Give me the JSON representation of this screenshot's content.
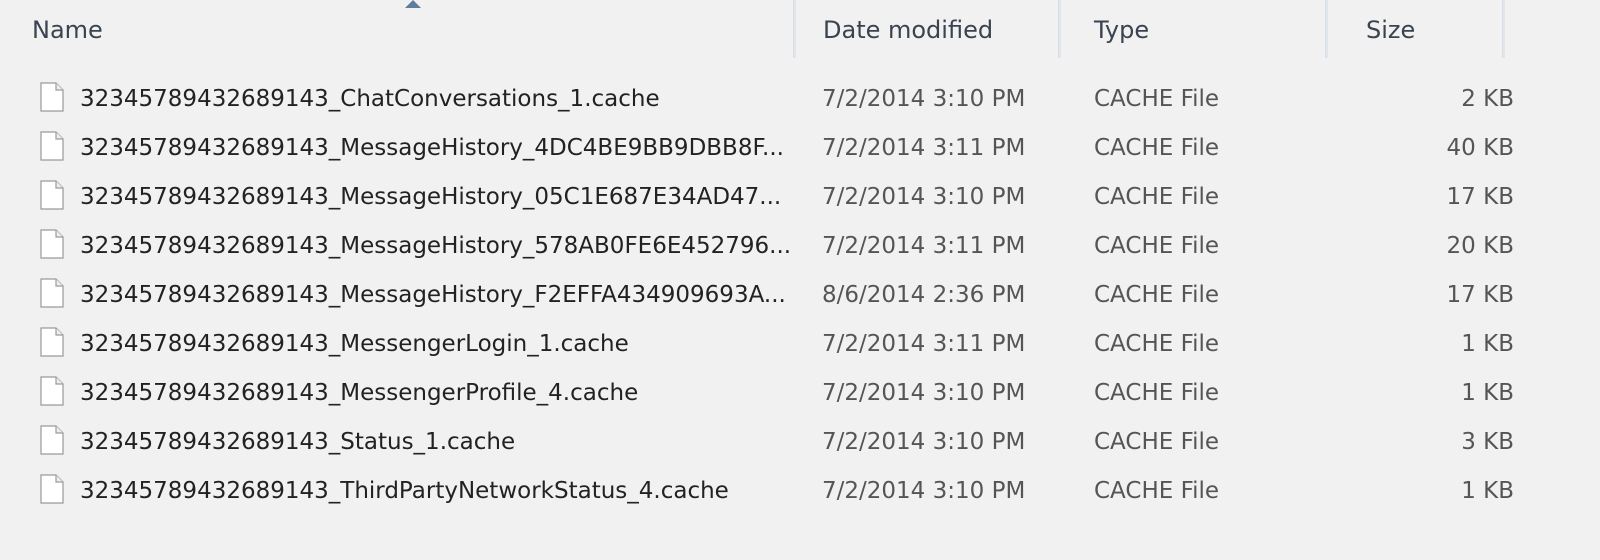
{
  "columns": {
    "name": "Name",
    "date_modified": "Date modified",
    "type": "Type",
    "size": "Size",
    "sort_icon": "sort-ascending-arrow"
  },
  "file_icon": "blank-document-icon",
  "files": [
    {
      "name": "32345789432689143_ChatConversations_1.cache",
      "date": "7/2/2014 3:10 PM",
      "type": "CACHE File",
      "size": "2 KB"
    },
    {
      "name": "32345789432689143_MessageHistory_4DC4BE9BB9DBB8F...",
      "date": "7/2/2014 3:11 PM",
      "type": "CACHE File",
      "size": "40 KB"
    },
    {
      "name": "32345789432689143_MessageHistory_05C1E687E34AD47...",
      "date": "7/2/2014 3:10 PM",
      "type": "CACHE File",
      "size": "17 KB"
    },
    {
      "name": "32345789432689143_MessageHistory_578AB0FE6E452796...",
      "date": "7/2/2014 3:11 PM",
      "type": "CACHE File",
      "size": "20 KB"
    },
    {
      "name": "32345789432689143_MessageHistory_F2EFFA434909693A...",
      "date": "8/6/2014 2:36 PM",
      "type": "CACHE File",
      "size": "17 KB"
    },
    {
      "name": "32345789432689143_MessengerLogin_1.cache",
      "date": "7/2/2014 3:11 PM",
      "type": "CACHE File",
      "size": "1 KB"
    },
    {
      "name": "32345789432689143_MessengerProfile_4.cache",
      "date": "7/2/2014 3:10 PM",
      "type": "CACHE File",
      "size": "1 KB"
    },
    {
      "name": "32345789432689143_Status_1.cache",
      "date": "7/2/2014 3:10 PM",
      "type": "CACHE File",
      "size": "3 KB"
    },
    {
      "name": "32345789432689143_ThirdPartyNetworkStatus_4.cache",
      "date": "7/2/2014 3:10 PM",
      "type": "CACHE File",
      "size": "1 KB"
    }
  ]
}
